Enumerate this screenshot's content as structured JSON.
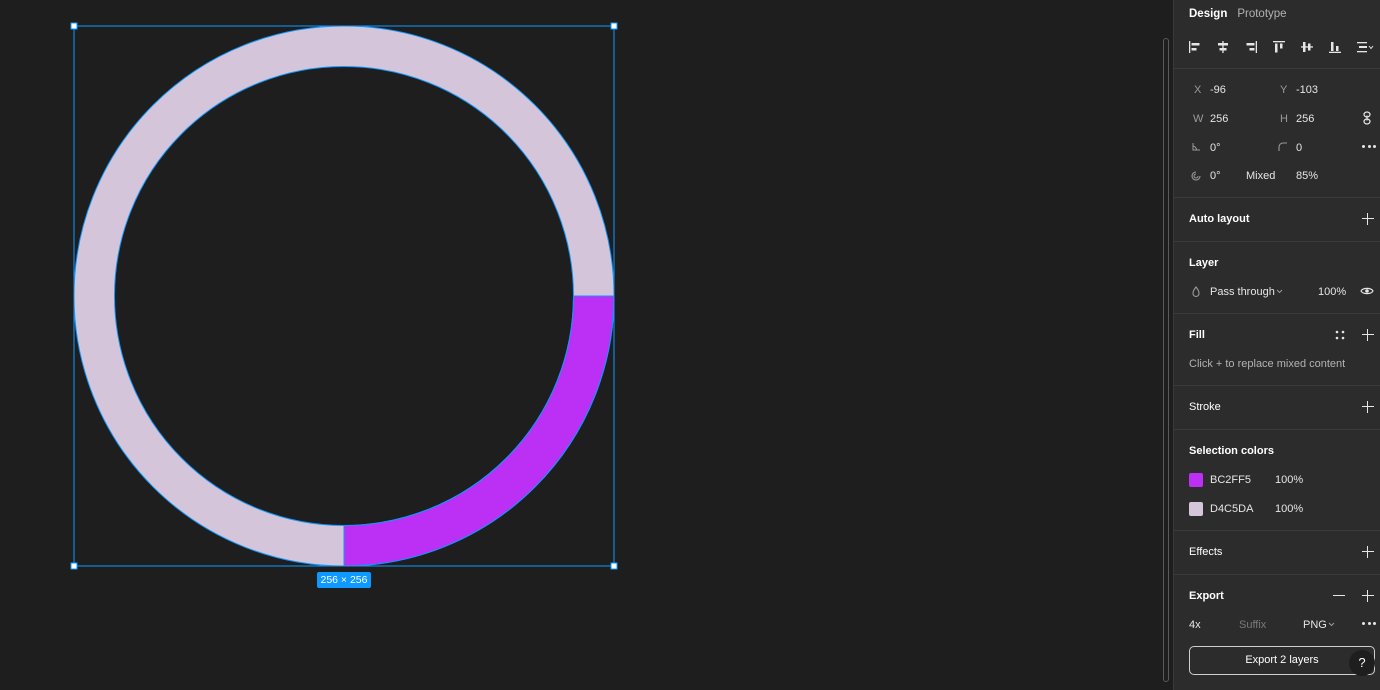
{
  "canvas": {
    "size_badge": "256 × 256",
    "colors": {
      "ring": "#D4C5DA",
      "arc": "#BC2FF5",
      "selection": "#0d99ff"
    },
    "arc_fraction": 0.25
  },
  "panel": {
    "tabs": [
      {
        "label": "Design",
        "active": true
      },
      {
        "label": "Prototype",
        "active": false
      }
    ],
    "align_icons": [
      "align-left-icon",
      "align-horizontal-center-icon",
      "align-right-icon",
      "align-top-icon",
      "align-vertical-center-icon",
      "align-bottom-icon",
      "distribute-icon"
    ],
    "transform": {
      "x_label": "X",
      "x_value": "-96",
      "y_label": "Y",
      "y_value": "-103",
      "w_label": "W",
      "w_value": "256",
      "h_label": "H",
      "h_value": "256",
      "rotation_value": "0°",
      "radius_value": "0",
      "arc_start": "0°",
      "arc_sweep": "Mixed",
      "arc_ratio": "85%"
    },
    "auto_layout": {
      "title": "Auto layout"
    },
    "layer": {
      "title": "Layer",
      "blend_mode": "Pass through",
      "opacity": "100%"
    },
    "fill": {
      "title": "Fill",
      "hint": "Click + to replace mixed content"
    },
    "stroke": {
      "title": "Stroke"
    },
    "selection_colors": {
      "title": "Selection colors",
      "items": [
        {
          "hex": "BC2FF5",
          "color": "#BC2FF5",
          "opacity": "100%"
        },
        {
          "hex": "D4C5DA",
          "color": "#D4C5DA",
          "opacity": "100%"
        }
      ]
    },
    "effects": {
      "title": "Effects"
    },
    "export": {
      "title": "Export",
      "scale": "4x",
      "suffix_placeholder": "Suffix",
      "format": "PNG",
      "button_label": "Export 2 layers",
      "help_label": "?"
    }
  }
}
